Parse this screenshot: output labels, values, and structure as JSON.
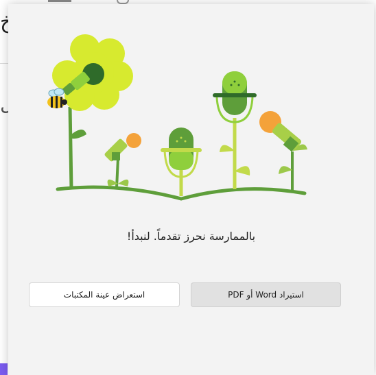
{
  "background": {
    "fragment_top": "خ",
    "fragment_middle": "ال"
  },
  "dialog": {
    "heading": "بالممارسة نحرز تقدماً. لنبدأ!",
    "buttons": {
      "import": "استيراد Word أو PDF",
      "browse": "استعراض عينة المكتبات"
    }
  },
  "colors": {
    "dialog_bg": "#f3f3f3",
    "leaf_green": "#5e9e3a",
    "light_green": "#c2da4a",
    "dark_green": "#2f6b2a",
    "flower_yellow": "#d7ea2f",
    "orange": "#f4a23a",
    "accent_purple": "#7b5cf0"
  }
}
